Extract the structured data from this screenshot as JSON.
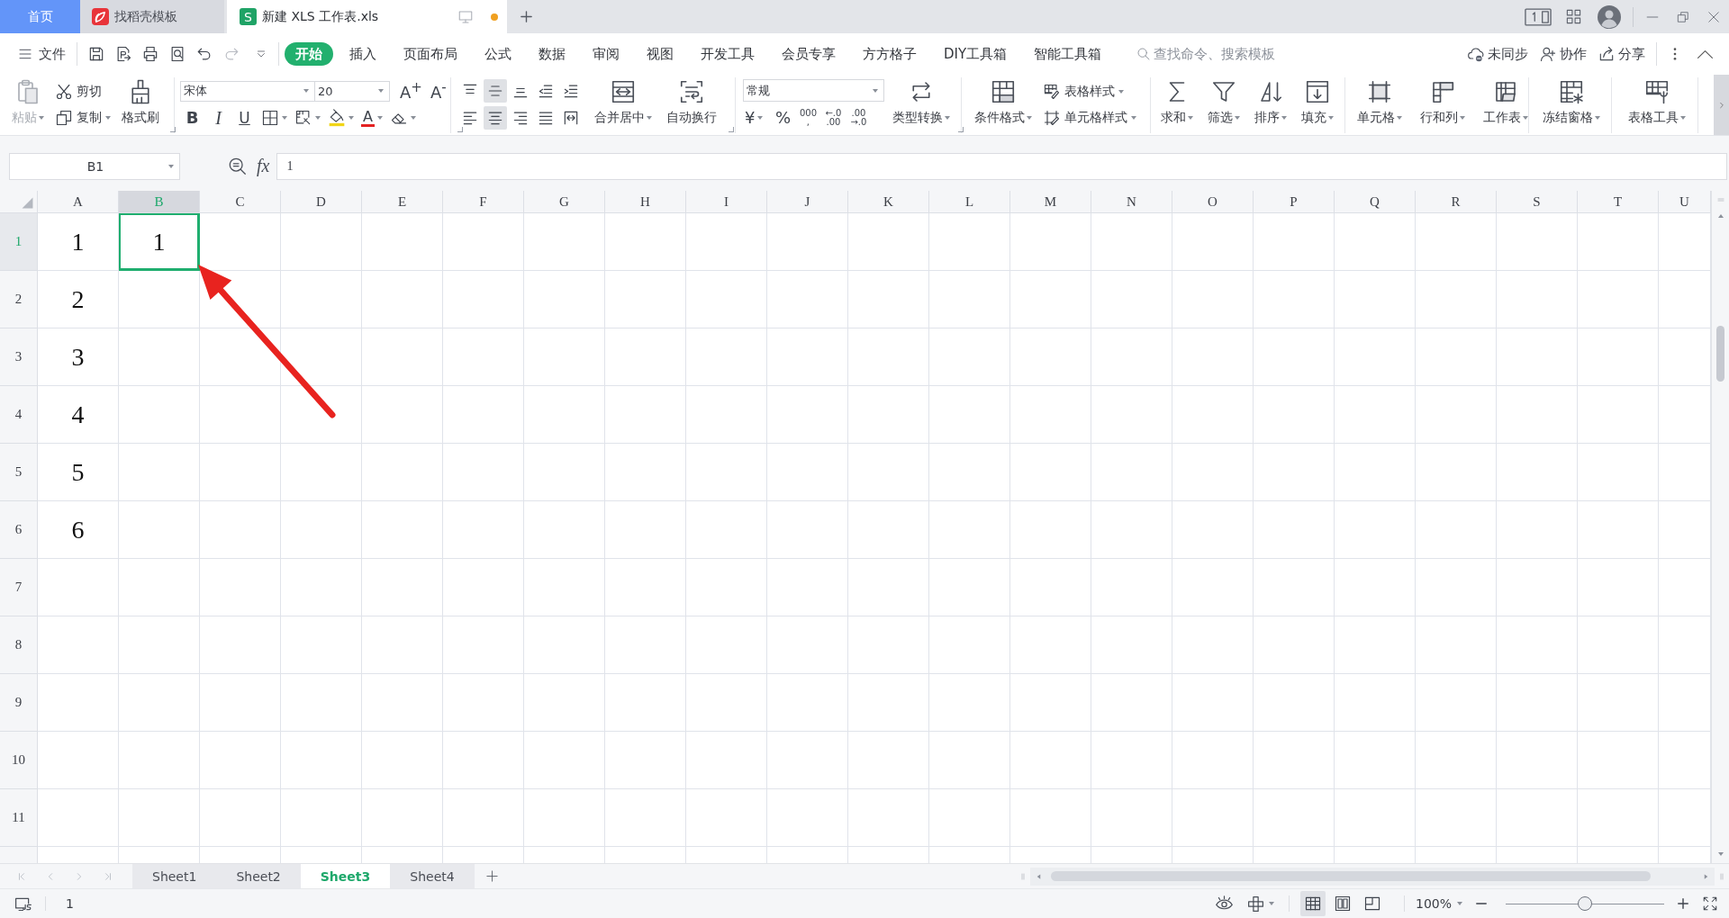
{
  "title_bar": {
    "tabs": [
      {
        "kind": "home",
        "label": "首页",
        "selected": false,
        "modified": false
      },
      {
        "kind": "docer",
        "label": "找稻壳模板",
        "selected": false,
        "modified": false
      },
      {
        "kind": "sheet",
        "logo": "S",
        "label": "新建 XLS 工作表.xls",
        "selected": true,
        "modified": true
      }
    ]
  },
  "menu": {
    "file": "文件",
    "quick_access": [
      {
        "kind": "save",
        "disabled": false
      },
      {
        "kind": "export",
        "disabled": false
      },
      {
        "kind": "print",
        "disabled": false
      },
      {
        "kind": "preview",
        "disabled": false
      },
      {
        "kind": "undo",
        "disabled": false
      },
      {
        "kind": "redo",
        "disabled": true
      },
      {
        "kind": "more",
        "disabled": false
      }
    ],
    "tabs": [
      {
        "label": "开始",
        "selected": true
      },
      {
        "label": "插入",
        "selected": false
      },
      {
        "label": "页面布局",
        "selected": false
      },
      {
        "label": "公式",
        "selected": false
      },
      {
        "label": "数据",
        "selected": false
      },
      {
        "label": "审阅",
        "selected": false
      },
      {
        "label": "视图",
        "selected": false
      },
      {
        "label": "开发工具",
        "selected": false
      },
      {
        "label": "会员专享",
        "selected": false
      },
      {
        "label": "方方格子",
        "selected": false
      },
      {
        "label": "DIY工具箱",
        "selected": false
      },
      {
        "label": "智能工具箱",
        "selected": false
      }
    ],
    "search": {
      "placeholder": "查找命令、搜索模板"
    },
    "actions": [
      {
        "kind": "sync",
        "label": "未同步"
      },
      {
        "kind": "collab",
        "label": "协作"
      },
      {
        "kind": "share",
        "label": "分享"
      }
    ]
  },
  "ribbon": {
    "groups": [
      {
        "launcher": true,
        "columns": [
          {
            "kind": "large",
            "items": [
              {
                "kind": "paste",
                "label": "粘贴",
                "dropdown": true,
                "disabled": true
              }
            ]
          },
          {
            "kind": "stack",
            "items": [
              {
                "kind": "cut",
                "label": "剪切"
              },
              {
                "kind": "copy",
                "label": "复制",
                "dropdown": true
              }
            ]
          },
          {
            "kind": "large",
            "items": [
              {
                "kind": "painter",
                "label": "格式刷"
              }
            ]
          }
        ]
      },
      {
        "launcher": true,
        "columns": [
          {
            "kind": "grid",
            "rows": [
              [
                {
                  "kind": "font",
                  "value": "宋体",
                  "dropdown": true
                },
                {
                  "kind": "size",
                  "value": "20",
                  "dropdown": true
                },
                {
                  "kind": "grow",
                  "label": "A$^{+}$"
                },
                {
                  "kind": "shrink",
                  "label": "A$^{-}$"
                }
              ],
              [
                {
                  "kind": "bold",
                  "label": "B"
                },
                {
                  "kind": "italic",
                  "label": "I"
                },
                {
                  "kind": "underline",
                  "label": "U"
                },
                {
                  "kind": "border",
                  "dropdown": true
                },
                {
                  "kind": "pattern",
                  "dropdown": true
                },
                {
                  "kind": "bucket",
                  "dropdown": true
                },
                {
                  "kind": "fontcolor",
                  "label": "A",
                  "dropdown": true
                },
                {
                  "kind": "eraser",
                  "dropdown": true
                }
              ]
            ]
          }
        ]
      },
      {
        "launcher": true,
        "columns": [
          {
            "kind": "grid",
            "rows": [
              [
                {
                  "kind": "top",
                  "selected": false
                },
                {
                  "kind": "middle",
                  "selected": true
                },
                {
                  "kind": "bottom",
                  "selected": false
                },
                {
                  "kind": "outdent",
                  "selected": false
                },
                {
                  "kind": "indent",
                  "selected": false
                }
              ],
              [
                {
                  "kind": "left",
                  "selected": false
                },
                {
                  "kind": "center",
                  "selected": true
                },
                {
                  "kind": "right",
                  "selected": false
                },
                {
                  "kind": "justify",
                  "selected": false
                },
                {
                  "kind": "distribute",
                  "selected": false
                }
              ]
            ]
          },
          {
            "kind": "large",
            "items": [
              {
                "kind": "merge",
                "label": "合并居中",
                "dropdown": true
              }
            ]
          },
          {
            "kind": "large",
            "items": [
              {
                "kind": "wrap",
                "label": "自动换行"
              }
            ]
          }
        ]
      },
      {
        "launcher": true,
        "columns": [
          {
            "kind": "grid",
            "rows": [
              [
                {
                  "kind": "format",
                  "value": "常规",
                  "dropdown": true
                }
              ],
              [
                {
                  "kind": "currency",
                  "label": "¥",
                  "dropdown": true
                },
                {
                  "kind": "percent",
                  "label": "%"
                },
                {
                  "kind": "thousands",
                  "lines": [
                    "000",
                    ","
                  ]
                },
                {
                  "kind": "moredecimal",
                  "lines": [
                    "←.0",
                    ".00"
                  ]
                },
                {
                  "kind": "lessdecimal",
                  "lines": [
                    ".00",
                    "→.0"
                  ]
                }
              ]
            ]
          },
          {
            "kind": "large",
            "items": [
              {
                "kind": "convert",
                "label": "类型转换",
                "dropdown": true
              }
            ]
          }
        ]
      },
      {
        "columns": [
          {
            "kind": "large",
            "items": [
              {
                "kind": "conditional",
                "label": "条件格式",
                "dropdown": true
              }
            ]
          },
          {
            "kind": "stack",
            "items": [
              {
                "kind": "tablestyle",
                "label": "表格样式",
                "dropdown": true
              },
              {
                "kind": "cellstyle",
                "label": "单元格样式",
                "dropdown": true
              }
            ]
          }
        ]
      },
      {
        "columns": [
          {
            "kind": "large",
            "items": [
              {
                "kind": "sum",
                "label": "求和",
                "dropdown": true
              }
            ]
          },
          {
            "kind": "large",
            "items": [
              {
                "kind": "filter",
                "label": "筛选",
                "dropdown": true
              }
            ]
          },
          {
            "kind": "large",
            "items": [
              {
                "kind": "sort",
                "label": "排序",
                "dropdown": true
              }
            ]
          },
          {
            "kind": "large",
            "items": [
              {
                "kind": "filldown",
                "label": "填充",
                "dropdown": true
              }
            ]
          }
        ]
      },
      {
        "columns": [
          {
            "kind": "large",
            "items": [
              {
                "kind": "cells",
                "label": "单元格",
                "dropdown": true
              }
            ]
          },
          {
            "kind": "large",
            "items": [
              {
                "kind": "rowcol",
                "label": "行和列",
                "dropdown": true
              }
            ]
          },
          {
            "kind": "large",
            "items": [
              {
                "kind": "sheet",
                "label": "工作表",
                "dropdown": true
              }
            ]
          }
        ]
      },
      {
        "columns": [
          {
            "kind": "large",
            "items": [
              {
                "kind": "freeze",
                "label": "冻结窗格",
                "dropdown": true
              }
            ]
          }
        ]
      },
      {
        "columns": [
          {
            "kind": "large",
            "items": [
              {
                "kind": "tools",
                "label": "表格工具",
                "dropdown": true
              }
            ]
          }
        ]
      }
    ]
  },
  "formula_bar": {
    "name_box": "B1",
    "function_label": "fx",
    "formula": "1"
  },
  "sheet": {
    "columns": [
      {
        "label": "A",
        "selected": false
      },
      {
        "label": "B",
        "selected": true
      },
      {
        "label": "C",
        "selected": false
      },
      {
        "label": "D",
        "selected": false
      },
      {
        "label": "E",
        "selected": false
      },
      {
        "label": "F",
        "selected": false
      },
      {
        "label": "G",
        "selected": false
      },
      {
        "label": "H",
        "selected": false
      },
      {
        "label": "I",
        "selected": false
      },
      {
        "label": "J",
        "selected": false
      },
      {
        "label": "K",
        "selected": false
      },
      {
        "label": "L",
        "selected": false
      },
      {
        "label": "M",
        "selected": false
      },
      {
        "label": "N",
        "selected": false
      },
      {
        "label": "O",
        "selected": false
      },
      {
        "label": "P",
        "selected": false
      },
      {
        "label": "Q",
        "selected": false
      },
      {
        "label": "R",
        "selected": false
      },
      {
        "label": "S",
        "selected": false
      },
      {
        "label": "T",
        "selected": false
      },
      {
        "label": "U",
        "selected": false
      }
    ],
    "rows": [
      {
        "label": "1",
        "selected": true,
        "cells": [
          {
            "value": "1",
            "selected": false
          },
          {
            "value": "1",
            "selected": true
          }
        ]
      },
      {
        "label": "2",
        "selected": false,
        "cells": [
          {
            "value": "2",
            "selected": false
          }
        ]
      },
      {
        "label": "3",
        "selected": false,
        "cells": [
          {
            "value": "3",
            "selected": false
          }
        ]
      },
      {
        "label": "4",
        "selected": false,
        "cells": [
          {
            "value": "4",
            "selected": false
          }
        ]
      },
      {
        "label": "5",
        "selected": false,
        "cells": [
          {
            "value": "5",
            "selected": false
          }
        ]
      },
      {
        "label": "6",
        "selected": false,
        "cells": [
          {
            "value": "6",
            "selected": false
          }
        ]
      },
      {
        "label": "7",
        "selected": false
      },
      {
        "label": "8",
        "selected": false
      },
      {
        "label": "9",
        "selected": false
      },
      {
        "label": "10",
        "selected": false
      },
      {
        "label": "11",
        "selected": false
      }
    ]
  },
  "annotations": [
    {
      "kind": "arrow"
    }
  ],
  "sheet_tabs": [
    {
      "label": "Sheet1",
      "selected": false
    },
    {
      "label": "Sheet2",
      "selected": false
    },
    {
      "label": "Sheet3",
      "selected": true
    },
    {
      "label": "Sheet4",
      "selected": false
    }
  ],
  "status_bar": {
    "value": "1",
    "views": [
      {
        "kind": "normal",
        "selected": true
      },
      {
        "kind": "pagebreak",
        "selected": false
      },
      {
        "kind": "reading",
        "selected": false
      }
    ],
    "zoom": {
      "label": "100%",
      "level": 0.5
    }
  }
}
